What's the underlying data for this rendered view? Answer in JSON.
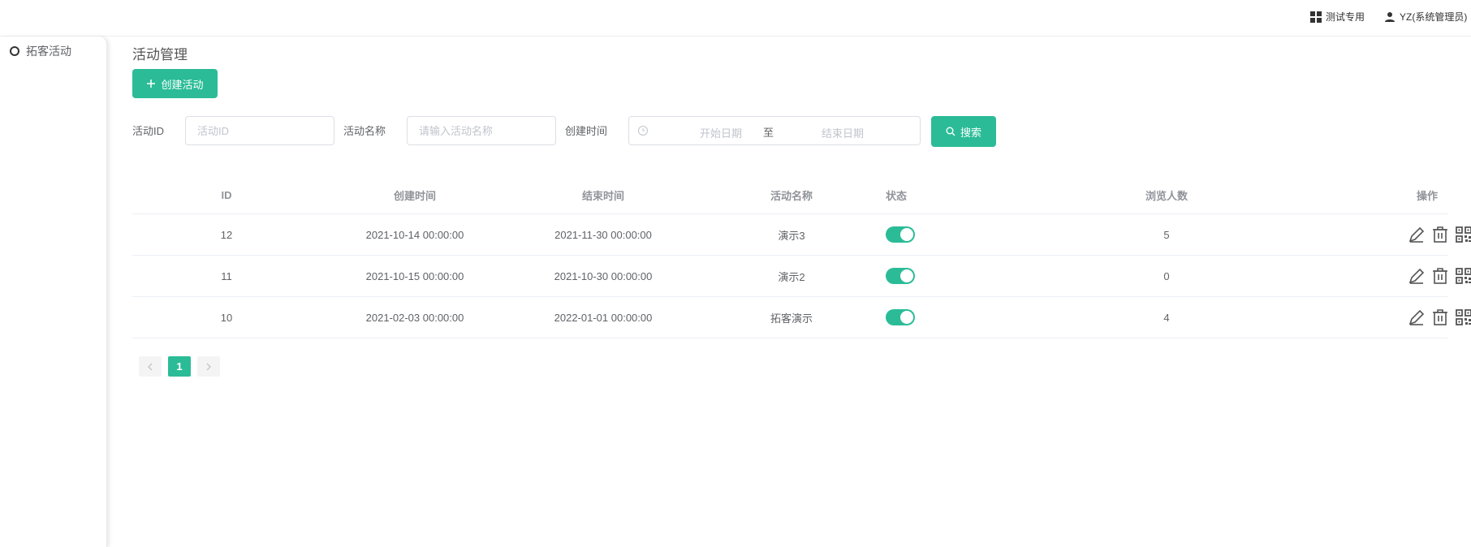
{
  "header": {
    "tenant_label": "测试专用",
    "user_label": "YZ(系统管理员)"
  },
  "sidebar": {
    "items": [
      {
        "label": "拓客活动"
      }
    ]
  },
  "main": {
    "title": "活动管理",
    "create_button": "创建活动",
    "filters": {
      "id_label": "活动ID",
      "id_placeholder": "活动ID",
      "name_label": "活动名称",
      "name_placeholder": "请输入活动名称",
      "time_label": "创建时间",
      "start_placeholder": "开始日期",
      "range_separator": "至",
      "end_placeholder": "结束日期",
      "search_button": "搜索"
    },
    "table": {
      "columns": [
        "ID",
        "创建时间",
        "结束时间",
        "活动名称",
        "状态",
        "浏览人数",
        "操作"
      ],
      "rows": [
        {
          "id": "12",
          "created": "2021-10-14 00:00:00",
          "ends": "2021-11-30 00:00:00",
          "name": "演示3",
          "enabled": true,
          "views": "5"
        },
        {
          "id": "11",
          "created": "2021-10-15 00:00:00",
          "ends": "2021-10-30 00:00:00",
          "name": "演示2",
          "enabled": true,
          "views": "0"
        },
        {
          "id": "10",
          "created": "2021-02-03 00:00:00",
          "ends": "2022-01-01 00:00:00",
          "name": "拓客演示",
          "enabled": true,
          "views": "4"
        }
      ],
      "row_actions": [
        "edit-icon",
        "delete-icon",
        "qrcode-icon",
        "share-icon",
        "support-icon"
      ]
    },
    "pagination": {
      "current_page": "1",
      "prev_icon": "chevron-left-icon",
      "next_icon": "chevron-right-icon"
    }
  },
  "colors": {
    "primary": "#2bbc97",
    "text": "#606266",
    "header_text": "#909399",
    "border": "#ebeef5"
  }
}
